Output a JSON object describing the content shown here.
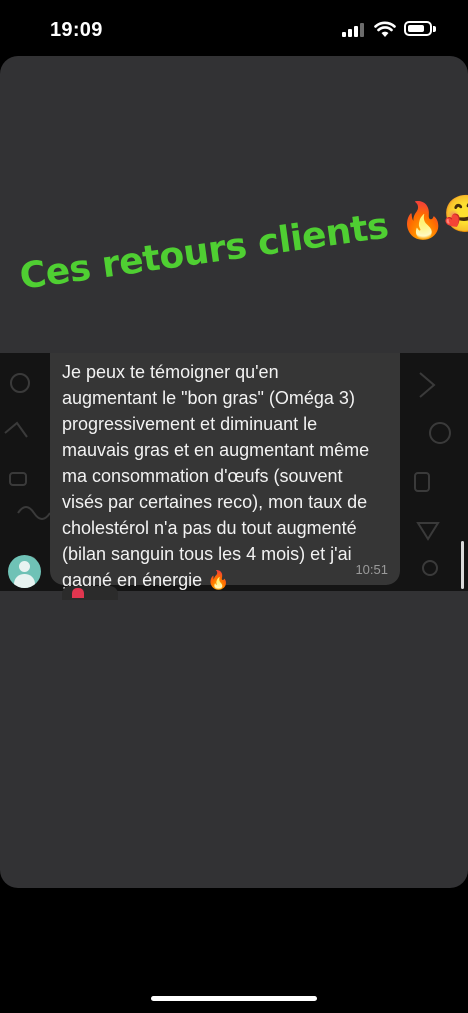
{
  "status_bar": {
    "time": "19:09",
    "battery_icon": "battery-icon",
    "wifi_icon": "wifi-icon",
    "signal_icon": "cellular-signal-icon"
  },
  "story": {
    "headline": "Ces retours clients",
    "headline_emojis": "🔥🥰🥰",
    "headline_color": "#4fcf32"
  },
  "chat": {
    "message": "Je peux te témoigner qu'en\naugmentant le \"bon gras\" (Oméga 3)\nprogressivement et diminuant le\nmauvais gras et en augmentant même\nma consommation d'œufs (souvent\nvisés par certaines reco), mon taux de\ncholestérol n'a pas du tout augmenté\n(bilan sanguin tous les 4 mois) et j'ai\ngagné en énergie 🔥",
    "time": "10:51",
    "avatar_icon": "default-avatar-icon",
    "reaction_icon": "heart-reaction-icon"
  }
}
